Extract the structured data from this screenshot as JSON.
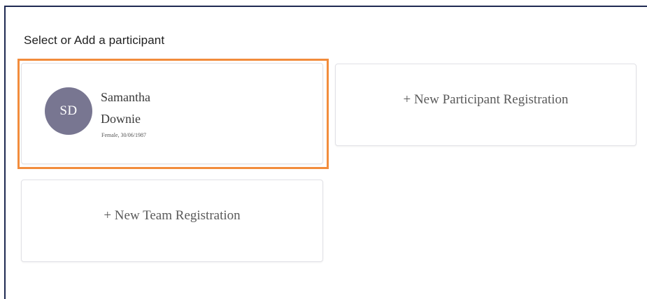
{
  "heading": "Select or Add a participant",
  "participant": {
    "initials": "SD",
    "first_name": "Samantha",
    "last_name": "Downie",
    "details": "Female, 30/06/1987"
  },
  "actions": {
    "new_participant": "+ New Participant Registration",
    "new_team": "+ New Team Registration"
  },
  "colors": {
    "highlight_border": "#f28c3c",
    "avatar_bg": "#787691",
    "frame_border": "#1f2a52"
  }
}
